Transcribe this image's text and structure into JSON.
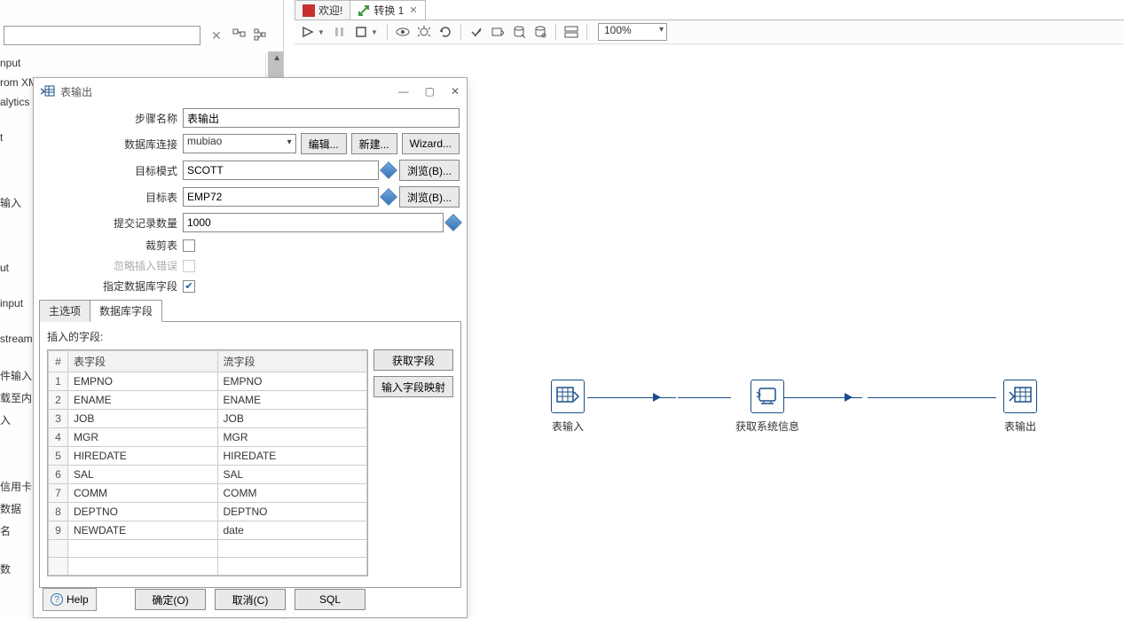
{
  "tabs": {
    "welcome": "欢迎!",
    "transform": "转换 1"
  },
  "toolbar": {
    "zoom": "100%"
  },
  "sidebar": {
    "items": [
      "nput",
      "rom XM",
      "alytics",
      "t",
      "输入",
      "ut",
      "input",
      "stream",
      "件输入",
      "载至内",
      "入",
      "信用卡",
      "数据",
      "名",
      "数"
    ]
  },
  "canvas": {
    "nodes": [
      {
        "label": "表输入"
      },
      {
        "label": "获取系统信息"
      },
      {
        "label": "表输出"
      }
    ]
  },
  "dialog": {
    "title": "表输出",
    "labels": {
      "step_name": "步骤名称",
      "db_conn": "数据库连接",
      "target_schema": "目标模式",
      "target_table": "目标表",
      "commit_size": "提交记录数量",
      "truncate": "裁剪表",
      "ignore_errors": "忽略插入错误",
      "specify_fields": "指定数据库字段"
    },
    "values": {
      "step_name": "表输出",
      "db_conn": "mubiao",
      "target_schema": "SCOTT",
      "target_table": "EMP72",
      "commit_size": "1000"
    },
    "buttons": {
      "edit": "编辑...",
      "new": "新建...",
      "wizard": "Wizard...",
      "browse": "浏览(B)...",
      "get_fields": "获取字段",
      "field_mapping": "输入字段映射",
      "help": "Help",
      "ok": "确定(O)",
      "cancel": "取消(C)",
      "sql": "SQL"
    },
    "tabs": {
      "main": "主选项",
      "fields": "数据库字段"
    },
    "fields_label": "插入的字段:",
    "grid": {
      "headers": {
        "num": "#",
        "table_field": "表字段",
        "stream_field": "流字段"
      },
      "rows": [
        {
          "n": "1",
          "a": "EMPNO",
          "b": "EMPNO"
        },
        {
          "n": "2",
          "a": "ENAME",
          "b": "ENAME"
        },
        {
          "n": "3",
          "a": "JOB",
          "b": "JOB"
        },
        {
          "n": "4",
          "a": "MGR",
          "b": "MGR"
        },
        {
          "n": "5",
          "a": "HIREDATE",
          "b": "HIREDATE"
        },
        {
          "n": "6",
          "a": "SAL",
          "b": "SAL"
        },
        {
          "n": "7",
          "a": "COMM",
          "b": "COMM"
        },
        {
          "n": "8",
          "a": "DEPTNO",
          "b": "DEPTNO"
        },
        {
          "n": "9",
          "a": "NEWDATE",
          "b": "date"
        }
      ]
    }
  }
}
